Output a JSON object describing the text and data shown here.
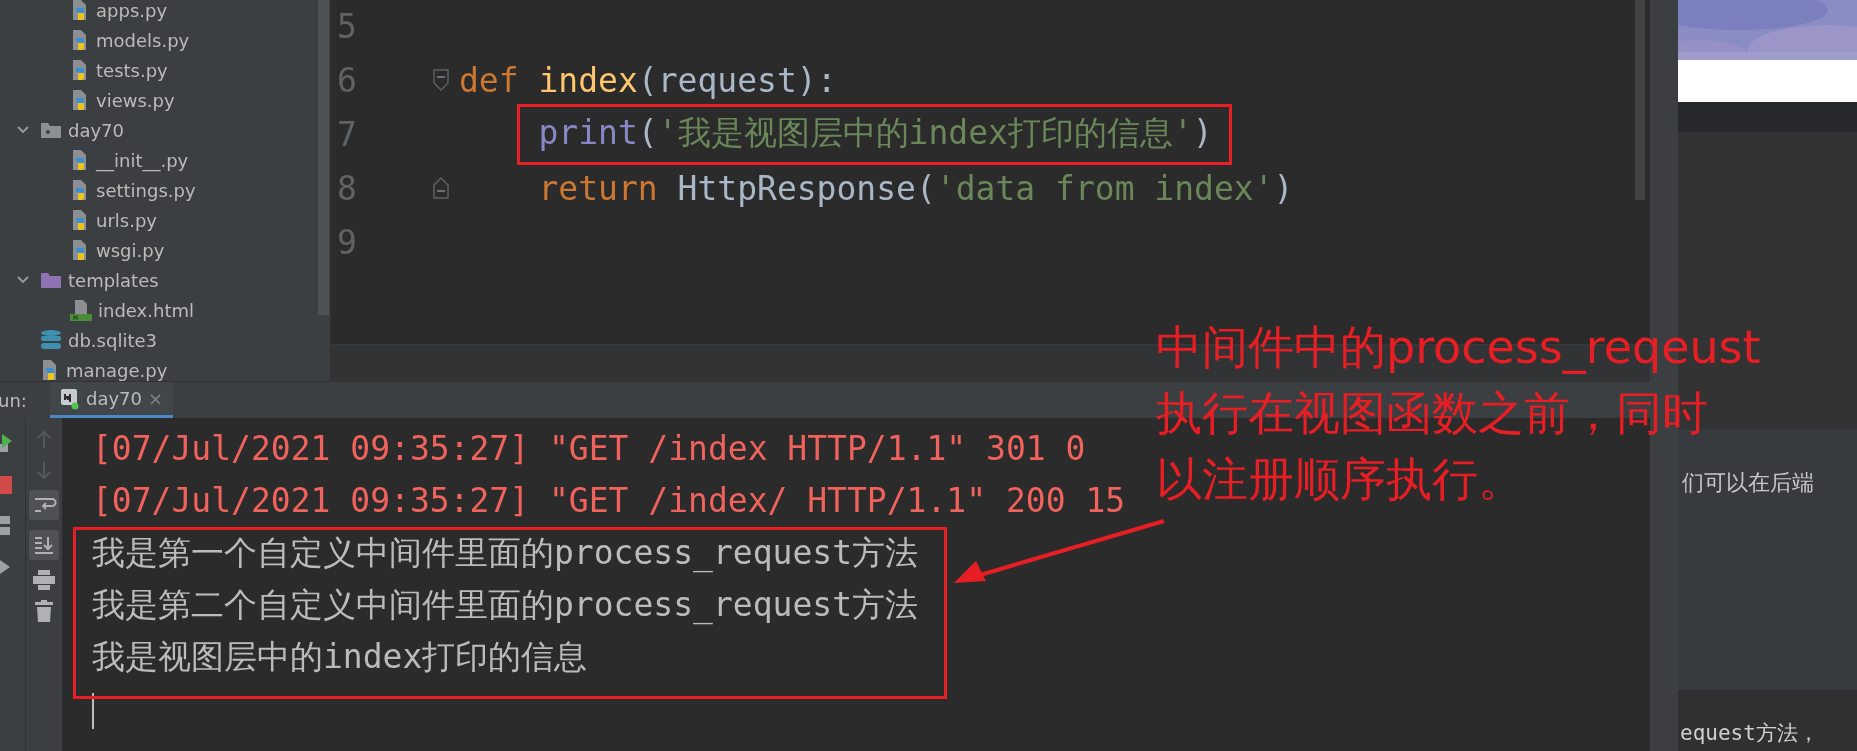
{
  "project_tree": {
    "nested_files": [
      {
        "label": "apps.py",
        "kind": "python"
      },
      {
        "label": "models.py",
        "kind": "python"
      },
      {
        "label": "tests.py",
        "kind": "python"
      },
      {
        "label": "views.py",
        "kind": "python"
      }
    ],
    "items": [
      {
        "label": "day70",
        "kind": "package",
        "expanded": true,
        "children": [
          {
            "label": "__init__.py",
            "kind": "python"
          },
          {
            "label": "settings.py",
            "kind": "python"
          },
          {
            "label": "urls.py",
            "kind": "python"
          },
          {
            "label": "wsgi.py",
            "kind": "python"
          }
        ]
      },
      {
        "label": "templates",
        "kind": "folder",
        "expanded": true,
        "children": [
          {
            "label": "index.html",
            "kind": "html"
          }
        ]
      },
      {
        "label": "db.sqlite3",
        "kind": "database"
      },
      {
        "label": "manage.py",
        "kind": "python"
      }
    ]
  },
  "editor": {
    "lines": [
      {
        "number": "5"
      },
      {
        "number": "6",
        "fold_start": true,
        "tokens": [
          {
            "text": "def ",
            "kind": "keyword"
          },
          {
            "text": "index",
            "kind": "function"
          },
          {
            "text": "(request):",
            "kind": "plain"
          }
        ]
      },
      {
        "number": "7",
        "indented": true,
        "highlighted": true,
        "tokens": [
          {
            "text": "print",
            "kind": "builtin"
          },
          {
            "text": "(",
            "kind": "plain"
          },
          {
            "text": "'我是视图层中的index打印的信息'",
            "kind": "string"
          },
          {
            "text": ")",
            "kind": "plain"
          }
        ]
      },
      {
        "number": "8",
        "fold_end": true,
        "indented": true,
        "tokens": [
          {
            "text": "return ",
            "kind": "keyword"
          },
          {
            "text": "HttpResponse(",
            "kind": "plain"
          },
          {
            "text": "'data from index'",
            "kind": "string"
          },
          {
            "text": ")",
            "kind": "plain"
          }
        ]
      },
      {
        "number": "9"
      }
    ]
  },
  "run_panel": {
    "label": "un:",
    "tabs": [
      {
        "label": "day70",
        "selected": true,
        "close": "×"
      }
    ],
    "console": [
      {
        "text": "[07/Jul/2021 09:35:27] \"GET /index HTTP/1.1\" 301 0",
        "kind": "error"
      },
      {
        "text": "[07/Jul/2021 09:35:27] \"GET /index/ HTTP/1.1\" 200 15",
        "kind": "error"
      },
      {
        "text": "我是第一个自定义中间件里面的process_request方法",
        "kind": "output"
      },
      {
        "text": "我是第二个自定义中间件里面的process_request方法",
        "kind": "output"
      },
      {
        "text": "我是视图层中的index打印的信息",
        "kind": "output"
      }
    ]
  },
  "browser": {
    "texts": [
      "们可以在后端",
      "equest方法，"
    ]
  },
  "annotation": {
    "lines": [
      "中间件中的process_reqeust",
      "执行在视图函数之前，同时",
      "以注册顺序执行。"
    ]
  }
}
